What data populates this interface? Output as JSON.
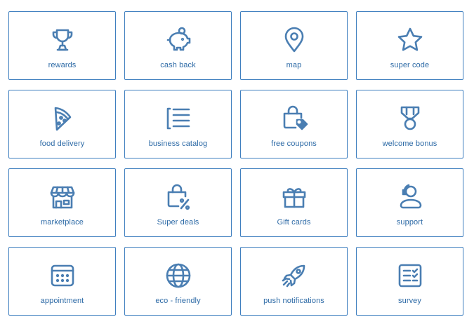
{
  "accent_color": "#3f7fbf",
  "icon_color": "#4a7eb2",
  "tiles": [
    {
      "label": "rewards",
      "icon": "trophy-icon"
    },
    {
      "label": "cash back",
      "icon": "piggy-bank-icon"
    },
    {
      "label": "map",
      "icon": "map-pin-icon"
    },
    {
      "label": "super code",
      "icon": "star-icon"
    },
    {
      "label": "food delivery",
      "icon": "pizza-slice-icon"
    },
    {
      "label": "business catalog",
      "icon": "catalog-list-icon"
    },
    {
      "label": "free coupons",
      "icon": "shopping-bag-tag-icon"
    },
    {
      "label": "welcome bonus",
      "icon": "medal-icon"
    },
    {
      "label": "marketplace",
      "icon": "storefront-icon"
    },
    {
      "label": "Super deals",
      "icon": "shopping-bag-percent-icon"
    },
    {
      "label": "Gift cards",
      "icon": "gift-icon"
    },
    {
      "label": "support",
      "icon": "support-agent-icon"
    },
    {
      "label": "appointment",
      "icon": "calendar-icon"
    },
    {
      "label": "eco - friendly",
      "icon": "globe-icon"
    },
    {
      "label": "push notifications",
      "icon": "rocket-icon"
    },
    {
      "label": "survey",
      "icon": "survey-checklist-icon"
    }
  ]
}
